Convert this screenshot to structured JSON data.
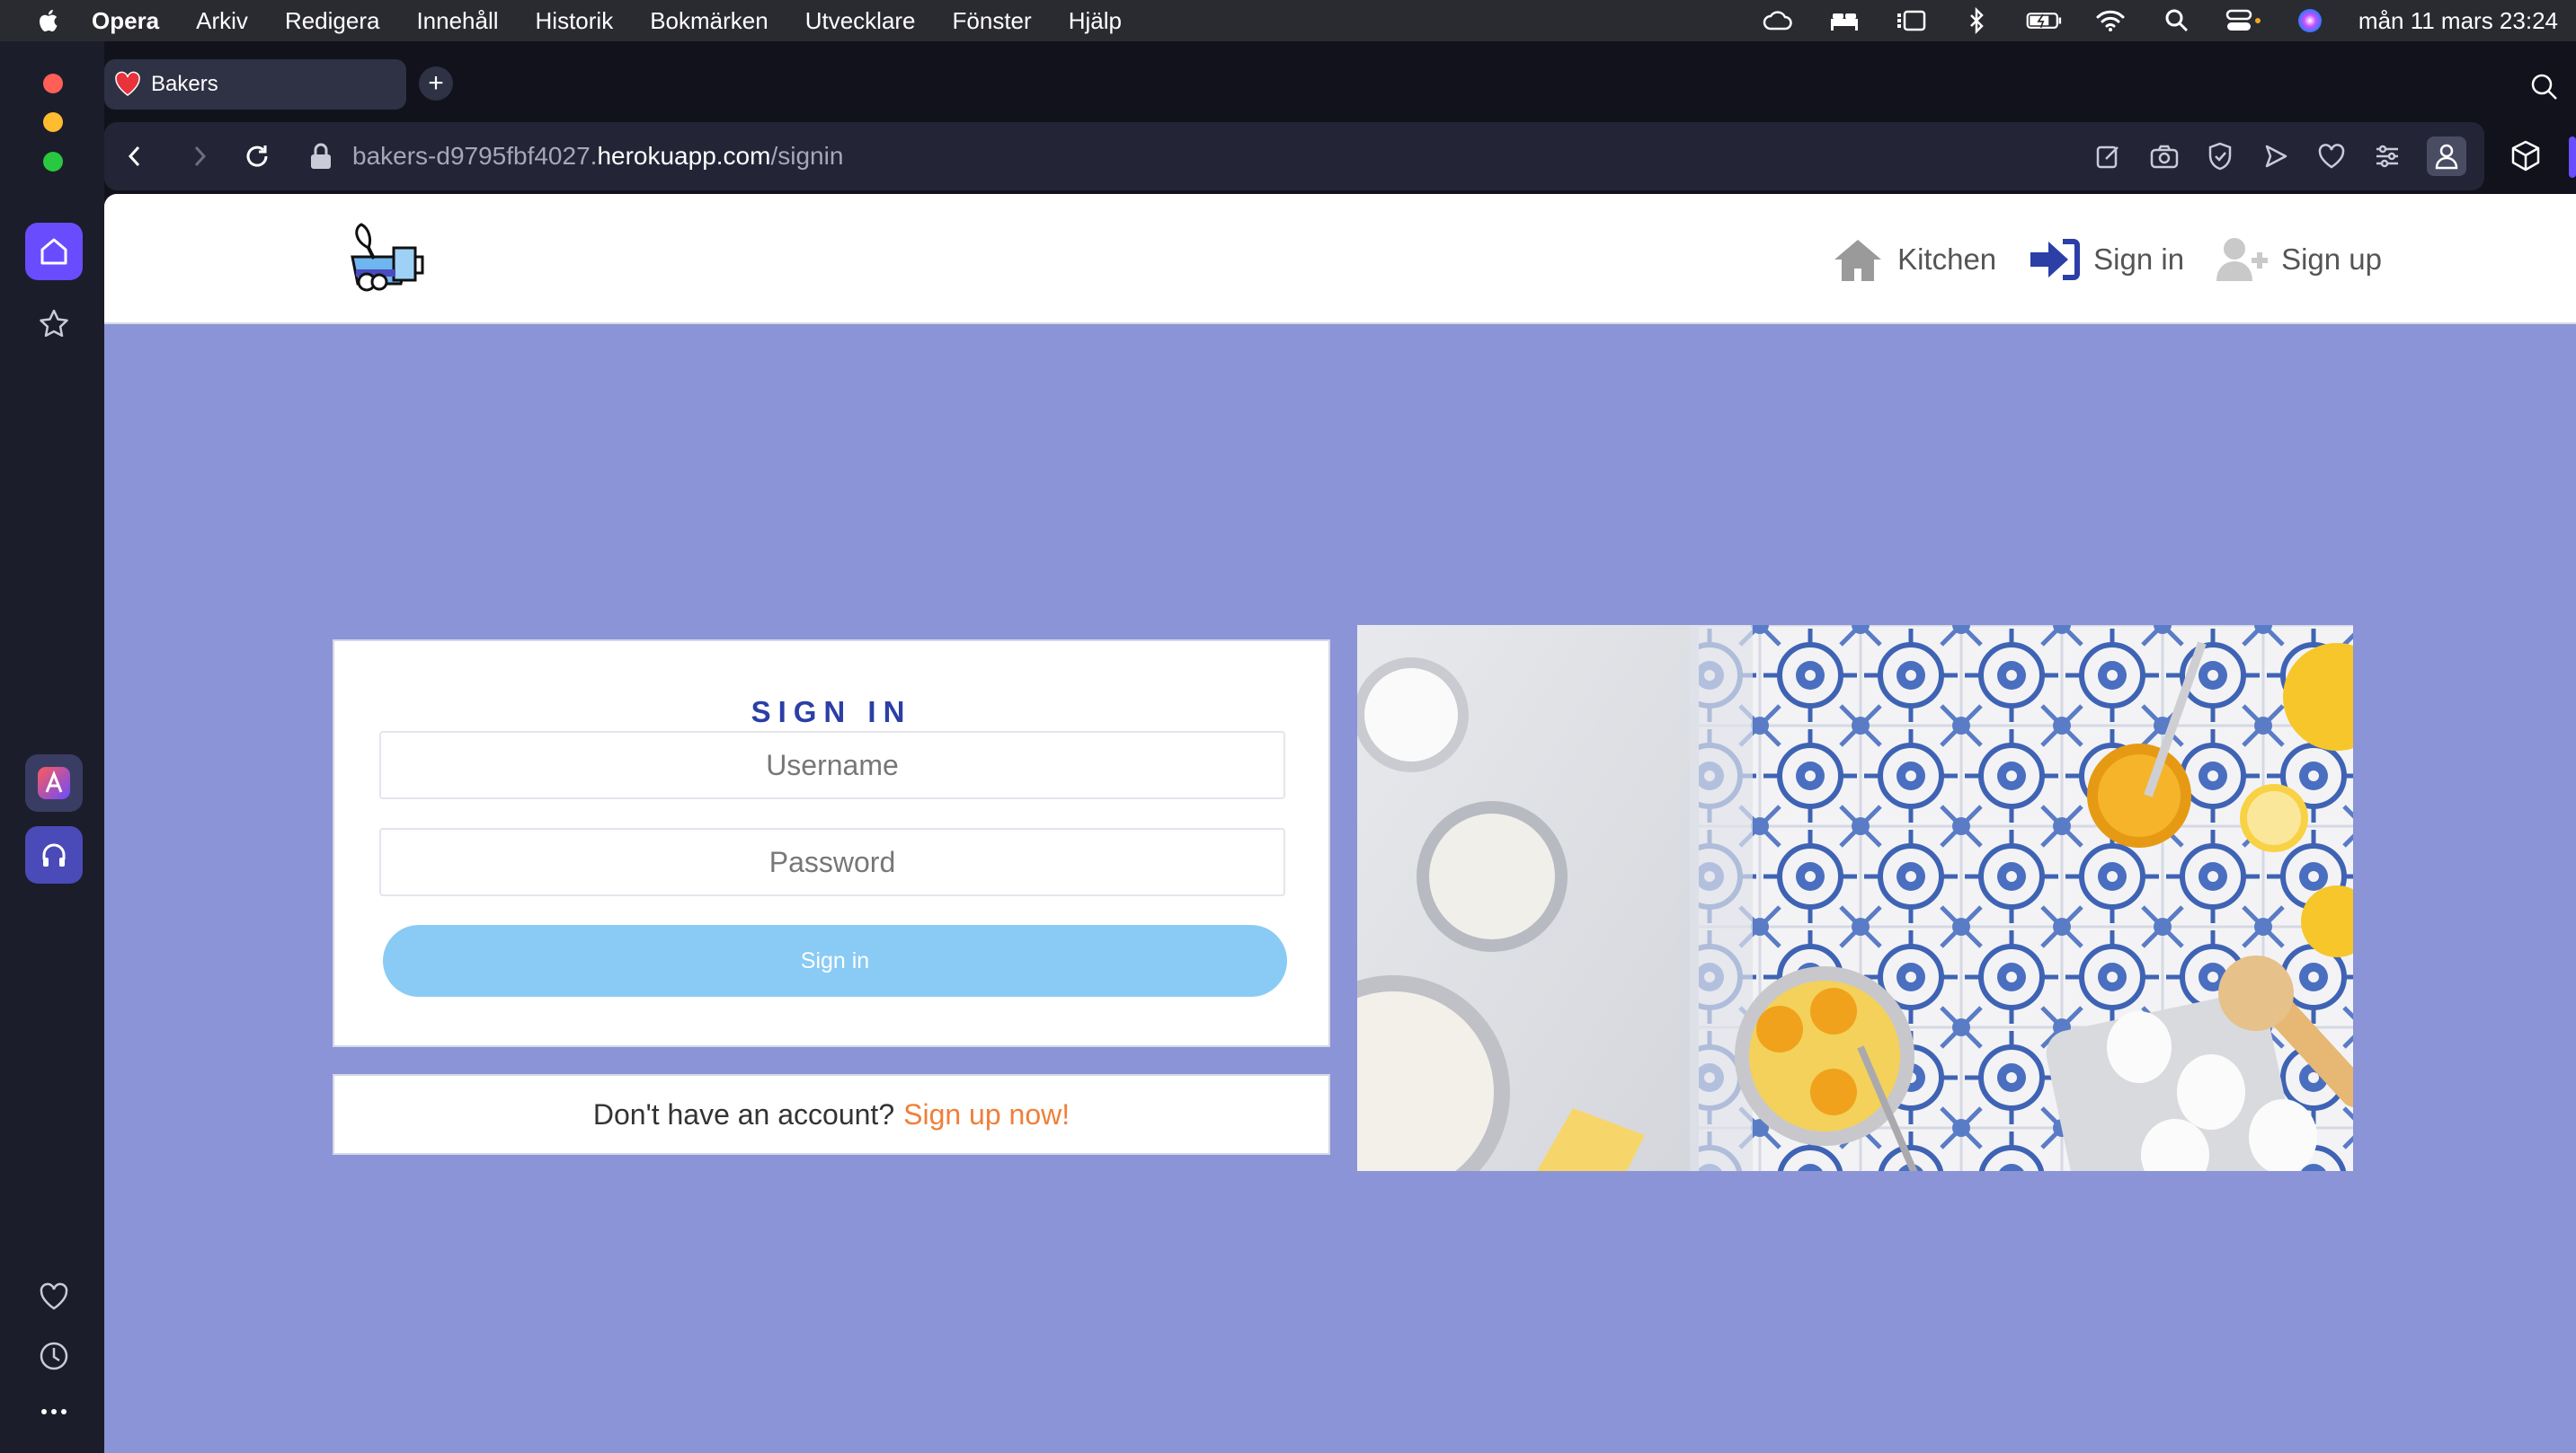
{
  "menubar": {
    "app_name": "Opera",
    "items": [
      "Arkiv",
      "Redigera",
      "Innehåll",
      "Historik",
      "Bokmärken",
      "Utvecklare",
      "Fönster",
      "Hjälp"
    ],
    "clock": "mån 11 mars 23:24"
  },
  "browser": {
    "tab_title": "Bakers",
    "new_tab_label": "+",
    "url_host": "bakers-d9795fbf4027.",
    "url_domain": "herokuapp.com",
    "url_path": "/signin",
    "accent_color": "#6a4cff"
  },
  "site": {
    "nav": {
      "kitchen": "Kitchen",
      "sign_in": "Sign in",
      "sign_up": "Sign up"
    },
    "signin": {
      "title": "SIGN IN",
      "username_placeholder": "Username",
      "password_placeholder": "Password",
      "button": "Sign in"
    },
    "signup_prompt": {
      "text": "Don't have an account?",
      "link": "Sign up now!"
    },
    "colors": {
      "page_bg": "#8b94d6",
      "title": "#2b3fa6",
      "button": "#89cbf5",
      "link": "#f07f3a"
    }
  }
}
